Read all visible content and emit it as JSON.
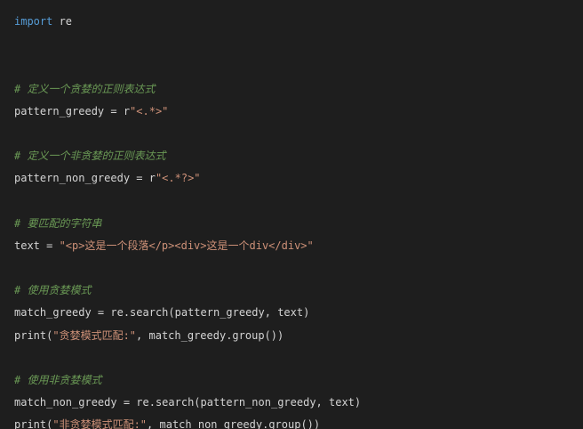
{
  "editor": {
    "lines": [
      [
        {
          "t": "keyword",
          "v": "import"
        },
        {
          "t": "plain",
          "v": " re"
        }
      ],
      [],
      [],
      [
        {
          "t": "comment",
          "v": "# 定义一个贪婪的正则表达式"
        }
      ],
      [
        {
          "t": "plain",
          "v": "pattern_greedy = r"
        },
        {
          "t": "string",
          "v": "\"<.*>\""
        }
      ],
      [],
      [
        {
          "t": "comment",
          "v": "# 定义一个非贪婪的正则表达式"
        }
      ],
      [
        {
          "t": "plain",
          "v": "pattern_non_greedy = r"
        },
        {
          "t": "string",
          "v": "\"<.*?>\""
        }
      ],
      [],
      [
        {
          "t": "comment",
          "v": "# 要匹配的字符串"
        }
      ],
      [
        {
          "t": "plain",
          "v": "text = "
        },
        {
          "t": "string",
          "v": "\"<p>这是一个段落</p><div>这是一个div</div>\""
        }
      ],
      [],
      [
        {
          "t": "comment",
          "v": "# 使用贪婪模式"
        }
      ],
      [
        {
          "t": "plain",
          "v": "match_greedy = re.search(pattern_greedy, text)"
        }
      ],
      [
        {
          "t": "plain",
          "v": "print("
        },
        {
          "t": "string",
          "v": "\"贪婪模式匹配:\""
        },
        {
          "t": "plain",
          "v": ", match_greedy.group())"
        }
      ],
      [],
      [
        {
          "t": "comment",
          "v": "# 使用非贪婪模式"
        }
      ],
      [
        {
          "t": "plain",
          "v": "match_non_greedy = re.search(pattern_non_greedy, text)"
        }
      ],
      [
        {
          "t": "plain",
          "v": "print("
        },
        {
          "t": "string",
          "v": "\"非贪婪模式匹配:\""
        },
        {
          "t": "plain",
          "v": ", match_non_greedy.group())"
        }
      ]
    ]
  },
  "colors": {
    "background": "#1e1e1e",
    "keyword": "#569cd6",
    "plain": "#d4d4d4",
    "comment": "#6a9955",
    "string": "#ce9178"
  }
}
